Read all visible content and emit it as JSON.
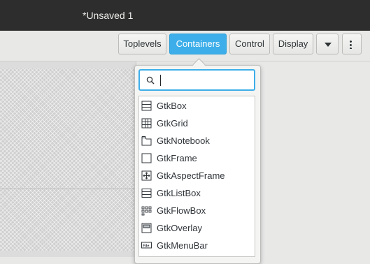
{
  "window": {
    "title": "*Unsaved 1"
  },
  "toolbar": {
    "buttons": [
      {
        "label": "Toplevels"
      },
      {
        "label": "Containers"
      },
      {
        "label": "Control"
      },
      {
        "label": "Display"
      }
    ],
    "active": "Containers",
    "more_menu_icon": "chevron-down-icon",
    "kebab_icon": "kebab-menu-icon"
  },
  "popover": {
    "search": {
      "value": "",
      "icon": "search-icon"
    },
    "items": [
      {
        "label": "GtkBox",
        "icon": "box-icon"
      },
      {
        "label": "GtkGrid",
        "icon": "grid-icon"
      },
      {
        "label": "GtkNotebook",
        "icon": "notebook-icon"
      },
      {
        "label": "GtkFrame",
        "icon": "frame-icon"
      },
      {
        "label": "GtkAspectFrame",
        "icon": "aspect-frame-icon"
      },
      {
        "label": "GtkListBox",
        "icon": "list-box-icon"
      },
      {
        "label": "GtkFlowBox",
        "icon": "flow-box-icon"
      },
      {
        "label": "GtkOverlay",
        "icon": "overlay-icon"
      },
      {
        "label": "GtkMenuBar",
        "icon": "menu-bar-icon"
      }
    ]
  },
  "colors": {
    "accent": "#3daee9",
    "titlebar": "#2d2d2d"
  }
}
